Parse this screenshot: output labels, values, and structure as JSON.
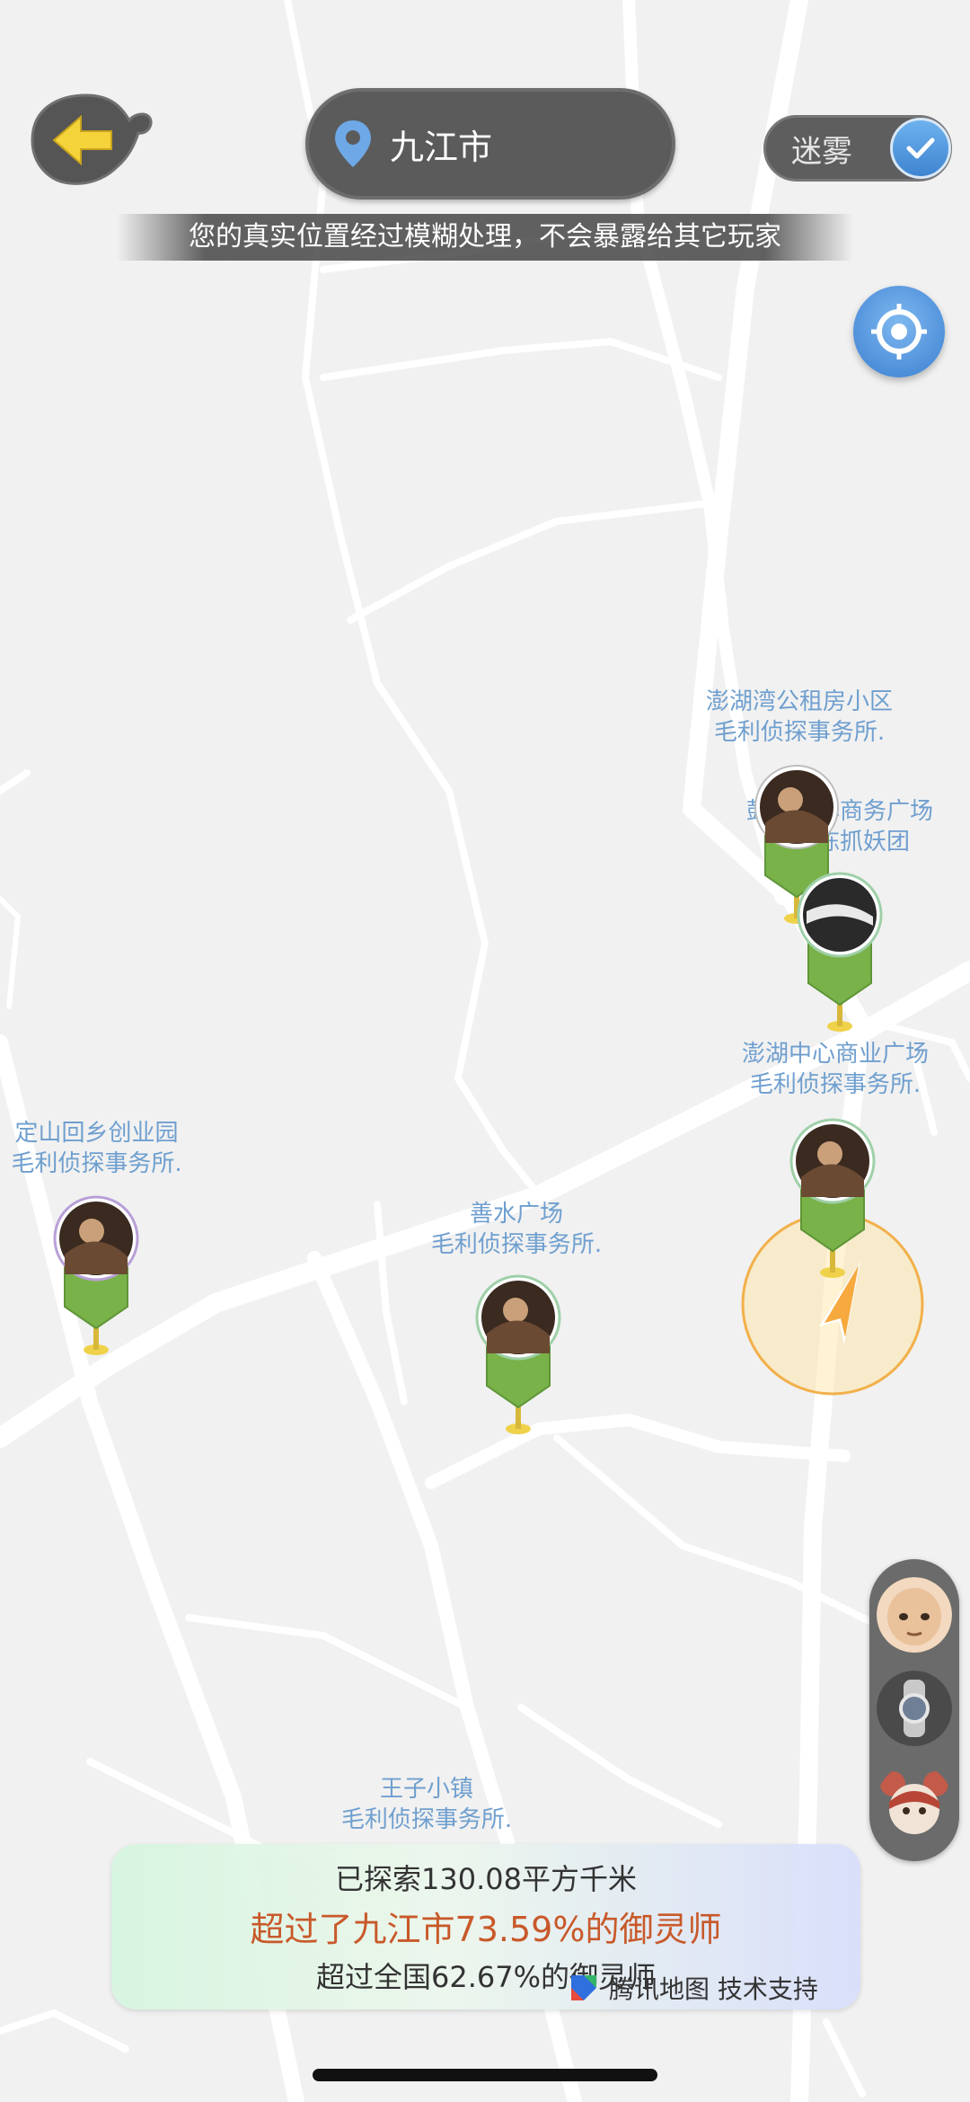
{
  "header": {
    "city": "九江市",
    "fog_label": "迷雾",
    "privacy_notice": "您的真实位置经过模糊处理，不会暴露给其它玩家"
  },
  "markers": [
    {
      "place": "澎湖湾公租房小区",
      "team": "毛利侦探事务所."
    },
    {
      "place": "鼓湖中心商务广场",
      "team": "江外陈抓妖团"
    },
    {
      "place": "澎湖中心商业广场",
      "team": "毛利侦探事务所."
    },
    {
      "place": "定山回乡创业园",
      "team": "毛利侦探事务所."
    },
    {
      "place": "善水广场",
      "team": "毛利侦探事务所."
    },
    {
      "place": "王子小镇",
      "team": "毛利侦探事务所."
    }
  ],
  "stats": {
    "explored": "已探索130.08平方千米",
    "city_rank": "超过了九江市73.59%的御灵师",
    "national_rank": "超过全国62.67%的御灵师"
  },
  "credit": "腾讯地图 技术支持",
  "icons": [
    "back-arrow-icon",
    "location-pin-icon",
    "check-icon",
    "locate-target-icon",
    "navigation-arrow-icon",
    "tencent-map-logo-icon"
  ],
  "colors": {
    "poi_label": "#6f9fcf",
    "rank_highlight": "#c8592a",
    "marker_green": "#7ab24a",
    "toggle_blue": "#3f84d0"
  }
}
